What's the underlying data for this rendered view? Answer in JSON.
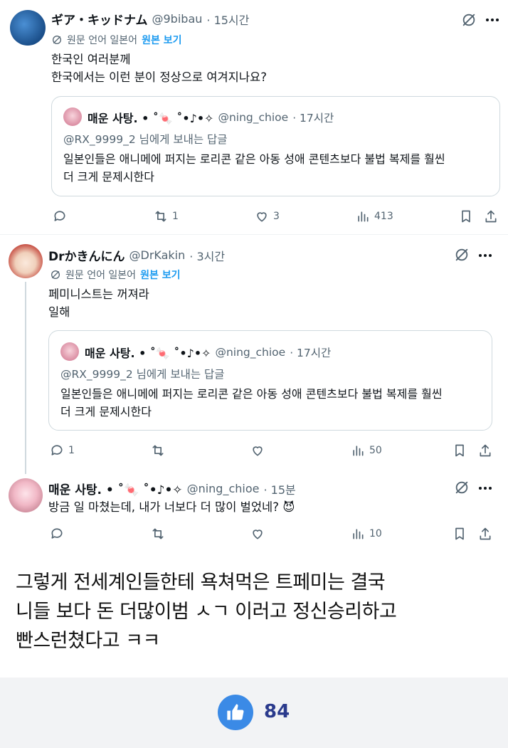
{
  "translate_label": "원문 언어 일본어",
  "show_original": "원본 보기",
  "posts": [
    {
      "name": "ギア・キッドナム",
      "handle": "@9bibau",
      "time": "· 15시간",
      "text": "한국인 여러분께\n한국에서는 이런 분이 정상으로 여겨지나요?",
      "quote": {
        "name": "매운 사탕. • ˚🍬 ˚•♪•✧",
        "handle": "@ning_chioe",
        "time": "· 17시간",
        "reply_to": "@RX_9999_2 님에게 보내는 답글",
        "text": "일본인들은 애니메에 퍼지는 로리콘 같은 아동 성애 콘텐츠보다 불법 복제를 훨씬\n더 크게 문제시한다"
      },
      "actions": {
        "replies": "",
        "reposts": "1",
        "likes": "3",
        "views": "413"
      }
    },
    {
      "name": "Drかきんにん",
      "handle": "@DrKakin",
      "time": "· 3시간",
      "text": "페미니스트는 꺼져라\n일해",
      "quote": {
        "name": "매운 사탕. • ˚🍬 ˚•♪•✧",
        "handle": "@ning_chioe",
        "time": "· 17시간",
        "reply_to": "@RX_9999_2 님에게 보내는 답글",
        "text": "일본인들은 애니메에 퍼지는 로리콘 같은 아동 성애 콘텐츠보다 불법 복제를 훨씬\n더 크게 문제시한다"
      },
      "actions": {
        "replies": "1",
        "reposts": "",
        "likes": "",
        "views": "50"
      }
    },
    {
      "name": "매운 사탕. • ˚🍬 ˚•♪•✧",
      "handle": "@ning_chioe",
      "time": "· 15분",
      "text": "방금 일 마쳤는데, 내가 너보다 더 많이 벌었네? 😈",
      "actions": {
        "replies": "",
        "reposts": "",
        "likes": "",
        "views": "10"
      }
    }
  ],
  "caption": "그렇게 전세계인들한테 욕쳐먹은 트페미는 결국\n니들 보다 돈 더많이범 ㅅㄱ 이러고 정신승리하고\n빤스런쳤다고 ㅋㅋ",
  "like_count": "84",
  "colors": {
    "accent": "#1d9bf0",
    "muted": "#536471",
    "like_button": "#3b8ae6",
    "like_count": "#2a3a8c"
  }
}
